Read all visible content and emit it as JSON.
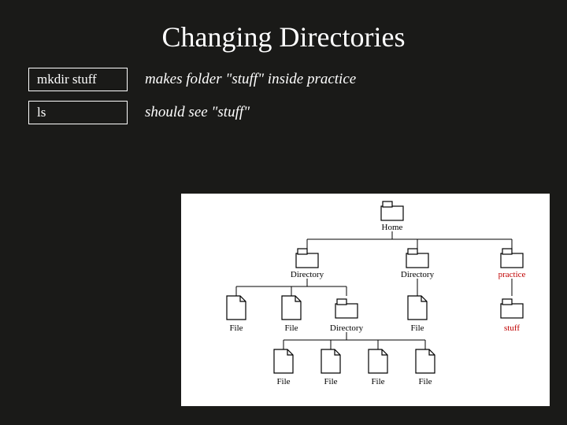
{
  "title": "Changing Directories",
  "commands": [
    {
      "cmd": "mkdir  stuff",
      "desc": "makes folder \"stuff\" inside practice"
    },
    {
      "cmd": "ls",
      "desc": "should see \"stuff\""
    }
  ],
  "tree": {
    "root": {
      "type": "folder",
      "label": "Home"
    },
    "level2": [
      {
        "type": "folder",
        "label": "Directory",
        "color": "black"
      },
      {
        "type": "folder",
        "label": "Directory",
        "color": "black"
      },
      {
        "type": "folder",
        "label": "practice",
        "color": "red"
      }
    ],
    "level3_left": [
      {
        "type": "file",
        "label": "File"
      },
      {
        "type": "file",
        "label": "File"
      },
      {
        "type": "folder",
        "label": "Directory"
      }
    ],
    "level3_mid": [
      {
        "type": "file",
        "label": "File"
      }
    ],
    "level3_right": [
      {
        "type": "folder",
        "label": "stuff",
        "color": "red"
      }
    ],
    "level4": [
      {
        "type": "file",
        "label": "File"
      },
      {
        "type": "file",
        "label": "File"
      },
      {
        "type": "file",
        "label": "File"
      },
      {
        "type": "file",
        "label": "File"
      }
    ]
  }
}
